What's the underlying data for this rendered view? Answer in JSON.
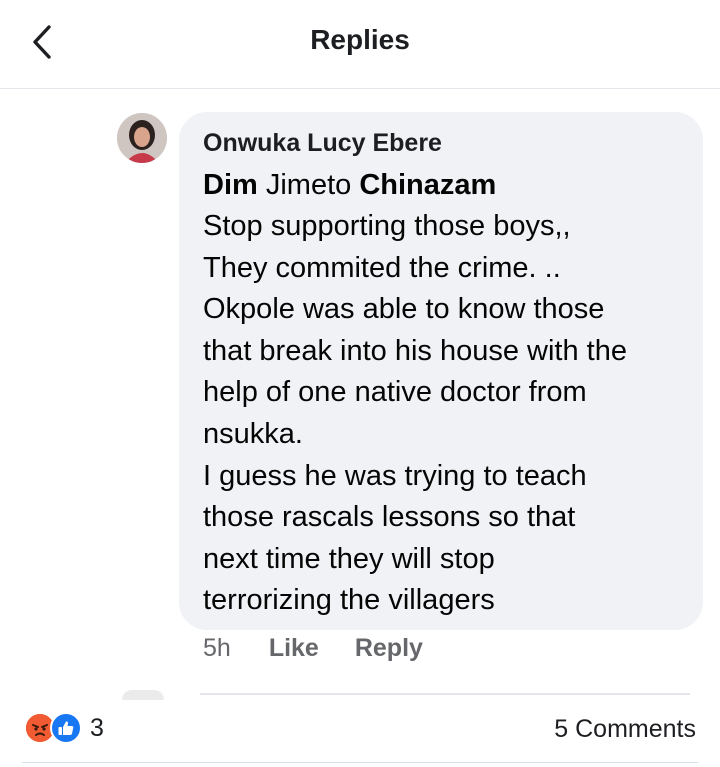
{
  "header": {
    "title": "Replies",
    "back_icon": "chevron-left-icon"
  },
  "comment": {
    "author": "Onwuka Lucy Ebere",
    "mentions": [
      "Dim",
      "Jimeto",
      "Chinazam"
    ],
    "lines": [
      "Stop supporting those boys,,",
      "They commited the crime. ..",
      "Okpole was able to know those",
      "that break into his house with the",
      "help of one native doctor from",
      "nsukka.",
      "I guess he was trying to teach",
      "those rascals lessons so that",
      "next time they will stop",
      "terrorizing the villagers"
    ],
    "time": "5h",
    "like_label": "Like",
    "reply_label": "Reply"
  },
  "footer": {
    "reactions": [
      "angry-icon",
      "like-icon"
    ],
    "reaction_count": "3",
    "comments_label": "5 Comments"
  },
  "colors": {
    "bubble_bg": "#f0f2f5",
    "meta_text": "#65676b",
    "like_blue": "#1877f2",
    "angry_orange": "#f05b33"
  }
}
